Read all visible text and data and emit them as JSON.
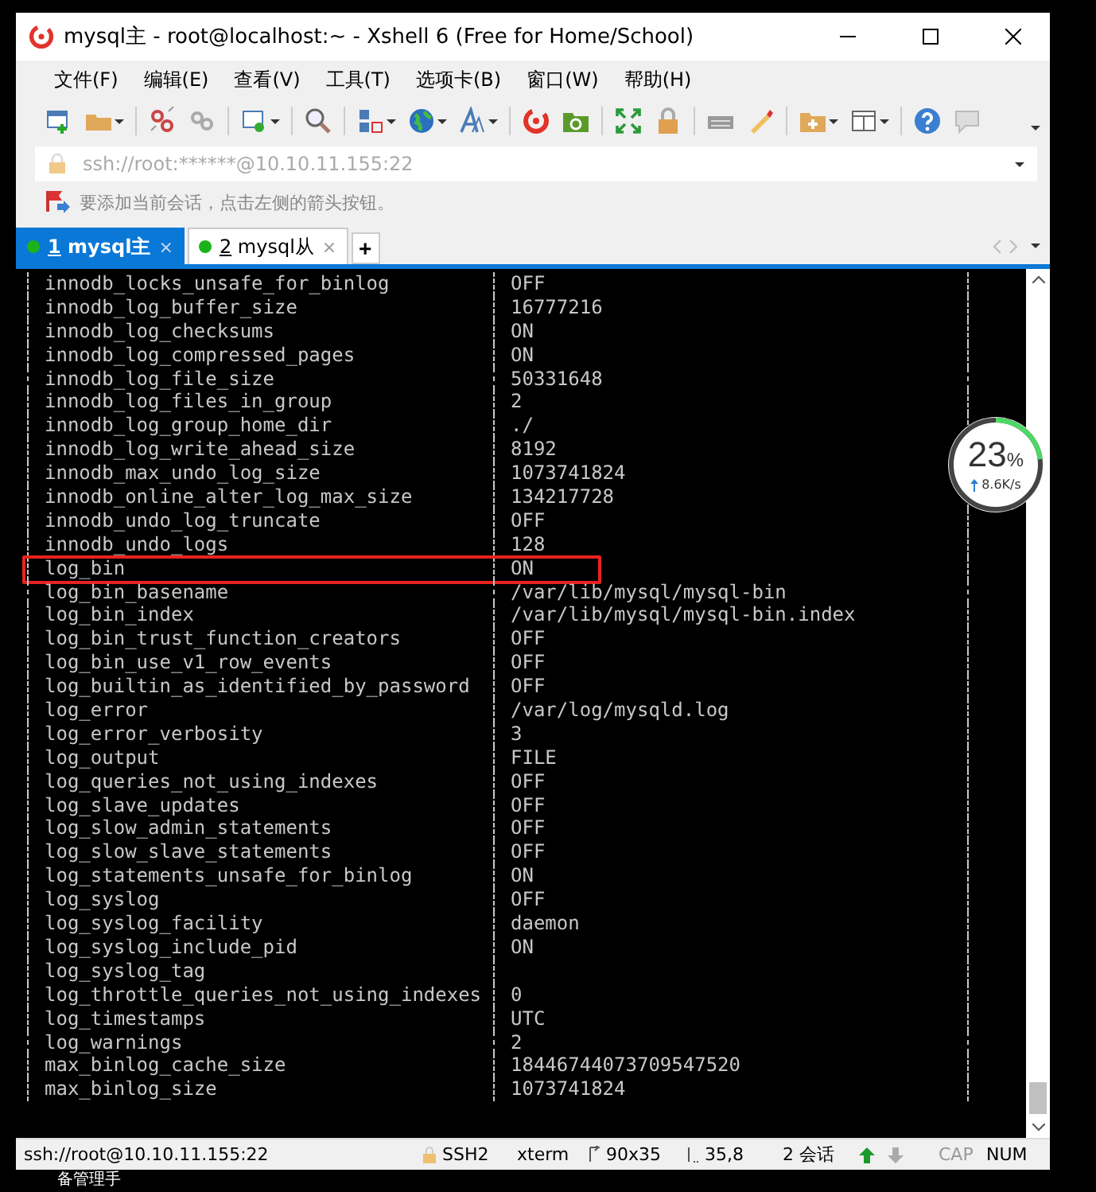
{
  "window": {
    "title": "mysql主 - root@localhost:~ - Xshell 6 (Free for Home/School)"
  },
  "menu": [
    "文件(F)",
    "编辑(E)",
    "查看(V)",
    "工具(T)",
    "选项卡(B)",
    "窗口(W)",
    "帮助(H)"
  ],
  "address_bar": {
    "value": "ssh://root:******@10.10.11.155:22"
  },
  "hint": "要添加当前会话，点击左侧的箭头按钮。",
  "tabs": [
    {
      "number": "1",
      "label": "mysql主",
      "close": "×",
      "selected": true
    },
    {
      "number": "2",
      "label": "mysql从",
      "close": "×",
      "selected": false
    }
  ],
  "new_tab": "+",
  "terminal": {
    "rows": [
      {
        "name": "innodb_locks_unsafe_for_binlog",
        "value": "OFF",
        "highlighted": false
      },
      {
        "name": "innodb_log_buffer_size",
        "value": "16777216",
        "highlighted": false
      },
      {
        "name": "innodb_log_checksums",
        "value": "ON",
        "highlighted": false
      },
      {
        "name": "innodb_log_compressed_pages",
        "value": "ON",
        "highlighted": false
      },
      {
        "name": "innodb_log_file_size",
        "value": "50331648",
        "highlighted": false
      },
      {
        "name": "innodb_log_files_in_group",
        "value": "2",
        "highlighted": false
      },
      {
        "name": "innodb_log_group_home_dir",
        "value": "./",
        "highlighted": false
      },
      {
        "name": "innodb_log_write_ahead_size",
        "value": "8192",
        "highlighted": false
      },
      {
        "name": "innodb_max_undo_log_size",
        "value": "1073741824",
        "highlighted": false
      },
      {
        "name": "innodb_online_alter_log_max_size",
        "value": "134217728",
        "highlighted": false
      },
      {
        "name": "innodb_undo_log_truncate",
        "value": "OFF",
        "highlighted": false
      },
      {
        "name": "innodb_undo_logs",
        "value": "128",
        "highlighted": false
      },
      {
        "name": "log_bin",
        "value": "ON",
        "highlighted": true
      },
      {
        "name": "log_bin_basename",
        "value": "/var/lib/mysql/mysql-bin",
        "highlighted": false
      },
      {
        "name": "log_bin_index",
        "value": "/var/lib/mysql/mysql-bin.index",
        "highlighted": false
      },
      {
        "name": "log_bin_trust_function_creators",
        "value": "OFF",
        "highlighted": false
      },
      {
        "name": "log_bin_use_v1_row_events",
        "value": "OFF",
        "highlighted": false
      },
      {
        "name": "log_builtin_as_identified_by_password",
        "value": "OFF",
        "highlighted": false
      },
      {
        "name": "log_error",
        "value": "/var/log/mysqld.log",
        "highlighted": false
      },
      {
        "name": "log_error_verbosity",
        "value": "3",
        "highlighted": false
      },
      {
        "name": "log_output",
        "value": "FILE",
        "highlighted": false
      },
      {
        "name": "log_queries_not_using_indexes",
        "value": "OFF",
        "highlighted": false
      },
      {
        "name": "log_slave_updates",
        "value": "OFF",
        "highlighted": false
      },
      {
        "name": "log_slow_admin_statements",
        "value": "OFF",
        "highlighted": false
      },
      {
        "name": "log_slow_slave_statements",
        "value": "OFF",
        "highlighted": false
      },
      {
        "name": "log_statements_unsafe_for_binlog",
        "value": "ON",
        "highlighted": false
      },
      {
        "name": "log_syslog",
        "value": "OFF",
        "highlighted": false
      },
      {
        "name": "log_syslog_facility",
        "value": "daemon",
        "highlighted": false
      },
      {
        "name": "log_syslog_include_pid",
        "value": "ON",
        "highlighted": false
      },
      {
        "name": "log_syslog_tag",
        "highlighted": false
      },
      {
        "name": "log_throttle_queries_not_using_indexes",
        "value": "0",
        "highlighted": false
      },
      {
        "name": "log_timestamps",
        "value": "UTC",
        "highlighted": false
      },
      {
        "name": "log_warnings",
        "value": "2",
        "highlighted": false
      },
      {
        "name": "max_binlog_cache_size",
        "value": "18446744073709547520",
        "highlighted": false
      },
      {
        "name": "max_binlog_size",
        "value": "1073741824",
        "highlighted": false
      }
    ]
  },
  "net_monitor": {
    "percent": "23",
    "unit": "%",
    "speed": "8.6K/s",
    "level": 0.23
  },
  "status_bar": {
    "address": "ssh://root@10.10.11.155:22",
    "protocol": "SSH2",
    "terminal": "xterm",
    "size": "90x35",
    "cursor": "35,8",
    "sessions": "2 会话",
    "cap": {
      "label": "CAP",
      "on": false
    },
    "num": {
      "label": "NUM",
      "on": true
    }
  },
  "background_text": "备管理手"
}
